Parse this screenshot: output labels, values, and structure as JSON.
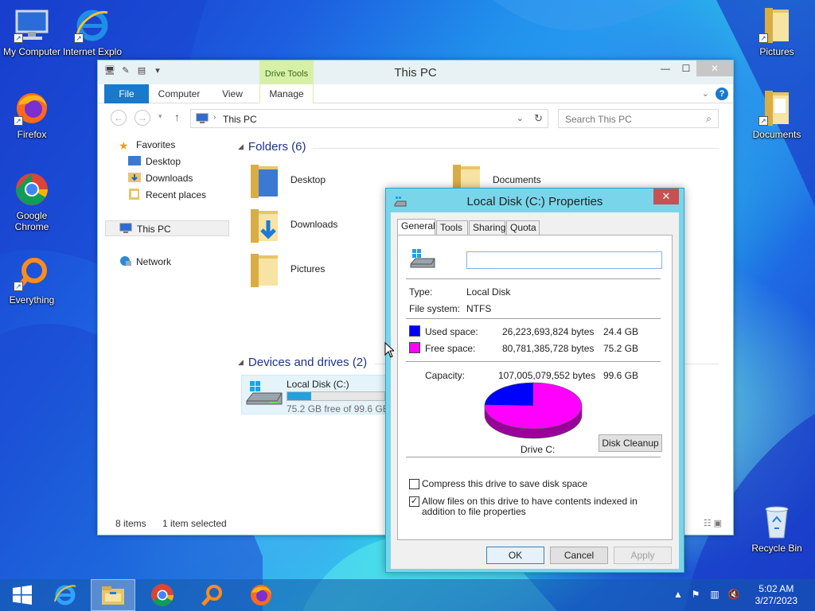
{
  "desktop": {
    "icons_left": [
      {
        "label": "My Computer",
        "icon": "computer-icon"
      },
      {
        "label": "Internet Explo",
        "icon": "internet-explorer-icon"
      },
      {
        "label": "Firefox",
        "icon": "firefox-icon"
      },
      {
        "label": "Google Chrome",
        "icon": "chrome-icon"
      },
      {
        "label": "Everything",
        "icon": "everything-search-icon"
      }
    ],
    "icons_right": [
      {
        "label": "Pictures",
        "icon": "folder-icon"
      },
      {
        "label": "Documents",
        "icon": "folder-icon"
      },
      {
        "label": "Recycle Bin",
        "icon": "recycle-bin-icon"
      }
    ]
  },
  "explorer": {
    "title": "This PC",
    "contextual_tab_group": "Drive Tools",
    "ribbon_tabs": [
      "File",
      "Computer",
      "View",
      "Manage"
    ],
    "address": "This PC",
    "search_placeholder": "Search This PC",
    "nav": {
      "favorites": "Favorites",
      "favorites_items": [
        "Desktop",
        "Downloads",
        "Recent places"
      ],
      "this_pc": "This PC",
      "network": "Network"
    },
    "folders_header": "Folders (6)",
    "folders": [
      "Desktop",
      "Documents",
      "Downloads",
      "Pictures"
    ],
    "devices_header": "Devices and drives (2)",
    "drive": {
      "name": "Local Disk (C:)",
      "free_text": "75.2 GB free of 99.6 GB",
      "used_fraction": 0.245
    },
    "status": {
      "items": "8 items",
      "selected": "1 item selected"
    }
  },
  "properties": {
    "title": "Local Disk (C:) Properties",
    "tabs": [
      "General",
      "Tools",
      "Sharing",
      "Quota"
    ],
    "selected_tab": "General",
    "name_value": "",
    "type_label": "Type:",
    "type_value": "Local Disk",
    "fs_label": "File system:",
    "fs_value": "NTFS",
    "used_label": "Used space:",
    "used_bytes": "26,223,693,824 bytes",
    "used_gb": "24.4 GB",
    "free_label": "Free space:",
    "free_bytes": "80,781,385,728 bytes",
    "free_gb": "75.2 GB",
    "capacity_label": "Capacity:",
    "capacity_bytes": "107,005,079,552 bytes",
    "capacity_gb": "99.6 GB",
    "drive_label": "Drive C:",
    "cleanup_button": "Disk Cleanup",
    "compress_label": "Compress this drive to save disk space",
    "compress_checked": false,
    "index_label": "Allow files on this drive to have contents indexed in addition to file properties",
    "index_checked": true,
    "ok": "OK",
    "cancel": "Cancel",
    "apply": "Apply",
    "used_color": "#0000ff",
    "free_color": "#ff00ff"
  },
  "chart_data": {
    "type": "pie",
    "categories": [
      "Used space",
      "Free space"
    ],
    "values": [
      24.4,
      75.2
    ],
    "colors": [
      "#0000ff",
      "#ff00ff"
    ]
  },
  "taskbar": {
    "apps": [
      "start-icon",
      "internet-explorer-icon",
      "file-explorer-icon",
      "chrome-icon",
      "everything-search-icon",
      "firefox-icon"
    ],
    "time": "5:02 AM",
    "date": "3/27/2023"
  }
}
